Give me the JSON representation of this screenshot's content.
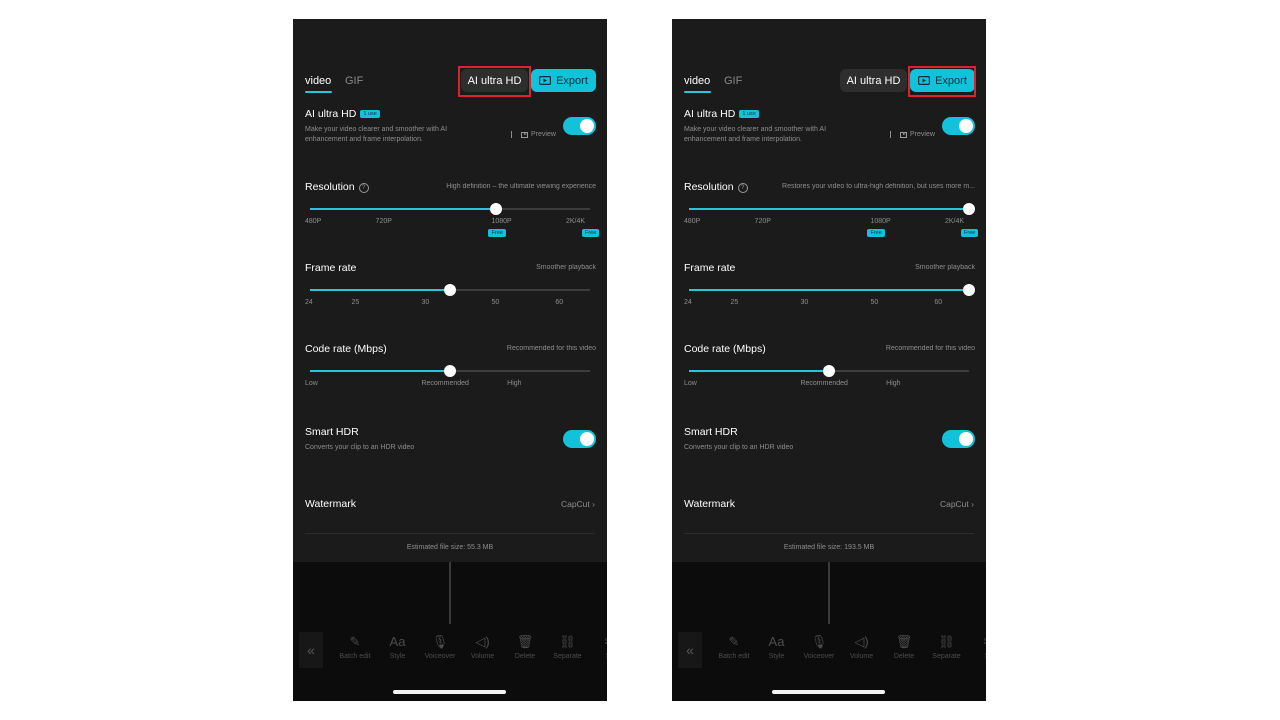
{
  "screens": [
    {
      "tabs": {
        "video": "video",
        "gif": "GIF"
      },
      "ai_button": "AI ultra HD",
      "export_button": "Export",
      "ai_section": {
        "title": "AI ultra HD",
        "badge": "1 use",
        "description": "Make your video clearer and smoother with AI enhancement and frame interpolation.",
        "preview": "Preview",
        "toggle_on": true
      },
      "resolution": {
        "title": "Resolution",
        "hint": "High definition – the ultimate viewing experience",
        "ticks": [
          "480P",
          "720P",
          "1080P",
          "2K/4K"
        ],
        "free_badge": "Free",
        "selected": "1080P"
      },
      "frame_rate": {
        "title": "Frame rate",
        "hint": "Smoother playback",
        "ticks": [
          "24",
          "25",
          "30",
          "50",
          "60"
        ],
        "selected": "30"
      },
      "code_rate": {
        "title": "Code rate (Mbps)",
        "hint": "Recommended for this video",
        "ticks": [
          "Low",
          "Recommended",
          "High"
        ],
        "selected": "Recommended"
      },
      "smart_hdr": {
        "title": "Smart HDR",
        "description": "Converts your clip to an HDR video",
        "toggle_on": true
      },
      "watermark": {
        "title": "Watermark",
        "value": "CapCut"
      },
      "file_size": "Estimated file size: 55.3 MB",
      "highlight": "ai_button",
      "toolbar": [
        "Batch edit",
        "Style",
        "Voiceover",
        "Volume",
        "Delete",
        "Separate",
        "Sp"
      ]
    },
    {
      "tabs": {
        "video": "video",
        "gif": "GIF"
      },
      "ai_button": "AI ultra HD",
      "export_button": "Export",
      "ai_section": {
        "title": "AI ultra HD",
        "badge": "1 use",
        "description": "Make your video clearer and smoother with AI enhancement and frame interpolation.",
        "preview": "Preview",
        "toggle_on": true
      },
      "resolution": {
        "title": "Resolution",
        "hint": "Restores your video to ultra-high definition, but uses more m...",
        "ticks": [
          "480P",
          "720P",
          "1080P",
          "2K/4K"
        ],
        "free_badge": "Free",
        "selected": "2K/4K"
      },
      "frame_rate": {
        "title": "Frame rate",
        "hint": "Smoother playback",
        "ticks": [
          "24",
          "25",
          "30",
          "50",
          "60"
        ],
        "selected": "60"
      },
      "code_rate": {
        "title": "Code rate (Mbps)",
        "hint": "Recommended for this video",
        "ticks": [
          "Low",
          "Recommended",
          "High"
        ],
        "selected": "Recommended"
      },
      "smart_hdr": {
        "title": "Smart HDR",
        "description": "Converts your clip to an HDR video",
        "toggle_on": true
      },
      "watermark": {
        "title": "Watermark",
        "value": "CapCut"
      },
      "file_size": "Estimated file size: 193.5 MB",
      "highlight": "export_button",
      "toolbar": [
        "Batch edit",
        "Style",
        "Voiceover",
        "Volume",
        "Delete",
        "Separate",
        "Sp"
      ]
    }
  ],
  "colors": {
    "accent": "#12c2db",
    "highlight": "#d8242e",
    "panel": "#1b1b1b"
  },
  "icons": {
    "toolbar": [
      "batch-edit-icon",
      "style-icon",
      "voiceover-icon",
      "volume-icon",
      "delete-icon",
      "separate-icon",
      "split-icon"
    ]
  }
}
